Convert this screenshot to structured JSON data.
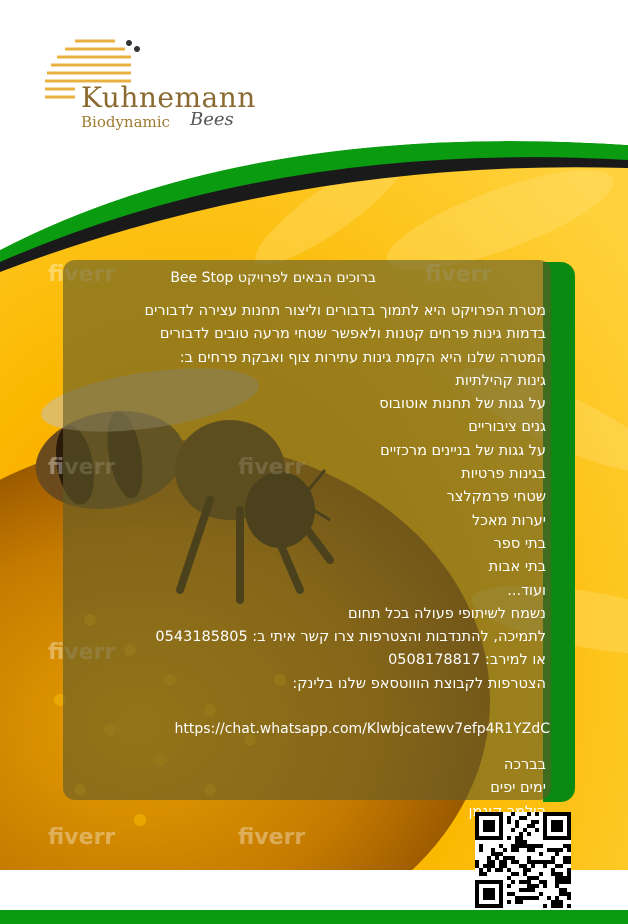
{
  "logo": {
    "name": "Kuhnemann",
    "subtitle": "Biodynamic",
    "script": "Bees"
  },
  "title": "ברוכים הבאים לפרויקט Bee Stop",
  "lines": [
    "מטרת הפרויקט היא לתמוך בדבורים וליצור תחנות עצירה לדבורים",
    "בדמות גינות פרחים קטנות ולאפשר שטחי מרעה טובים לדבורים",
    "המטרה שלנו היא הקמת גינות עתירות צוף ואבקת פרחים ב:",
    "גינות קהילתיות",
    "על גגות של תחנות אוטובוס",
    "גנים ציבוריים",
    "על גגות של בניינים מרכזיים",
    "בגינות פרטיות",
    "שטחי פרמקלצר",
    "יערות מאכל",
    "בתי ספר",
    "בתי אבות",
    "ועוד...",
    "נשמח לשיתופי פעולה בכל תחום",
    "לתמיכה, להתנדבות והצטרפות צרו קשר איתי ב: 0543185805",
    "או למירב: 0508178817",
    "הצטרפות לקבוצת הוווטסאפ שלנו בלינק:"
  ],
  "link": "https://chat.whatsapp.com/Klwbjcatewv7efp4R1YZdC",
  "signature": [
    "בברכה",
    "ימים יפים",
    "הילמר קונמן"
  ],
  "watermark": "fiverr",
  "colors": {
    "green": "#0a9b10",
    "orange": "#f7a800",
    "panel": "#5f5a28"
  }
}
